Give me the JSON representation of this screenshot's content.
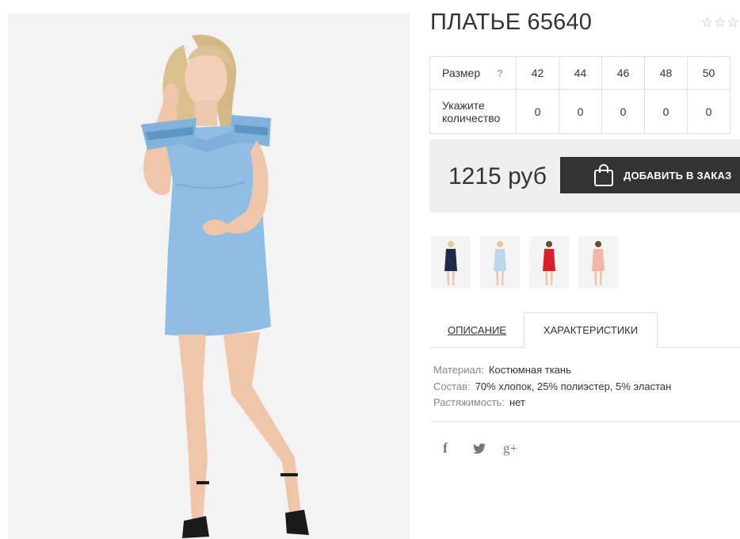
{
  "product": {
    "title": "ПЛАТЬЕ 65640",
    "rating_stars": "☆☆☆",
    "main_image_alt": "model-in-light-blue-dress"
  },
  "size_table": {
    "size_label": "Размер",
    "help_label": "?",
    "quantity_label": "Укажите количество",
    "sizes": [
      "42",
      "44",
      "46",
      "48",
      "50"
    ],
    "quantities": [
      "0",
      "0",
      "0",
      "0",
      "0"
    ]
  },
  "purchase": {
    "price": "1215 руб",
    "add_button_label": "ДОБАВИТЬ В ЗАКАЗ",
    "icon": "shopping-bag-icon"
  },
  "color_variants": [
    {
      "name": "navy",
      "color": "#1d2a4a"
    },
    {
      "name": "light-blue",
      "color": "#bcd6ea"
    },
    {
      "name": "red",
      "color": "#d9202a"
    },
    {
      "name": "pink",
      "color": "#f0b7a8"
    }
  ],
  "tabs": {
    "description": "ОПИСАНИЕ",
    "characteristics": "ХАРАКТЕРИСТИКИ"
  },
  "characteristics": [
    {
      "key": "Материал:",
      "value": "Костюмная ткань"
    },
    {
      "key": "Состав:",
      "value": "70% хлопок, 25% полиэстер, 5% эластан"
    },
    {
      "key": "Растяжимость:",
      "value": "нет"
    }
  ],
  "social": {
    "facebook": "f",
    "google_plus": "g+",
    "icons": [
      "facebook-icon",
      "twitter-icon",
      "google-plus-icon"
    ]
  },
  "colors": {
    "dress": "#8fbde3",
    "button": "#333333",
    "buybox_bg": "#efefef"
  }
}
